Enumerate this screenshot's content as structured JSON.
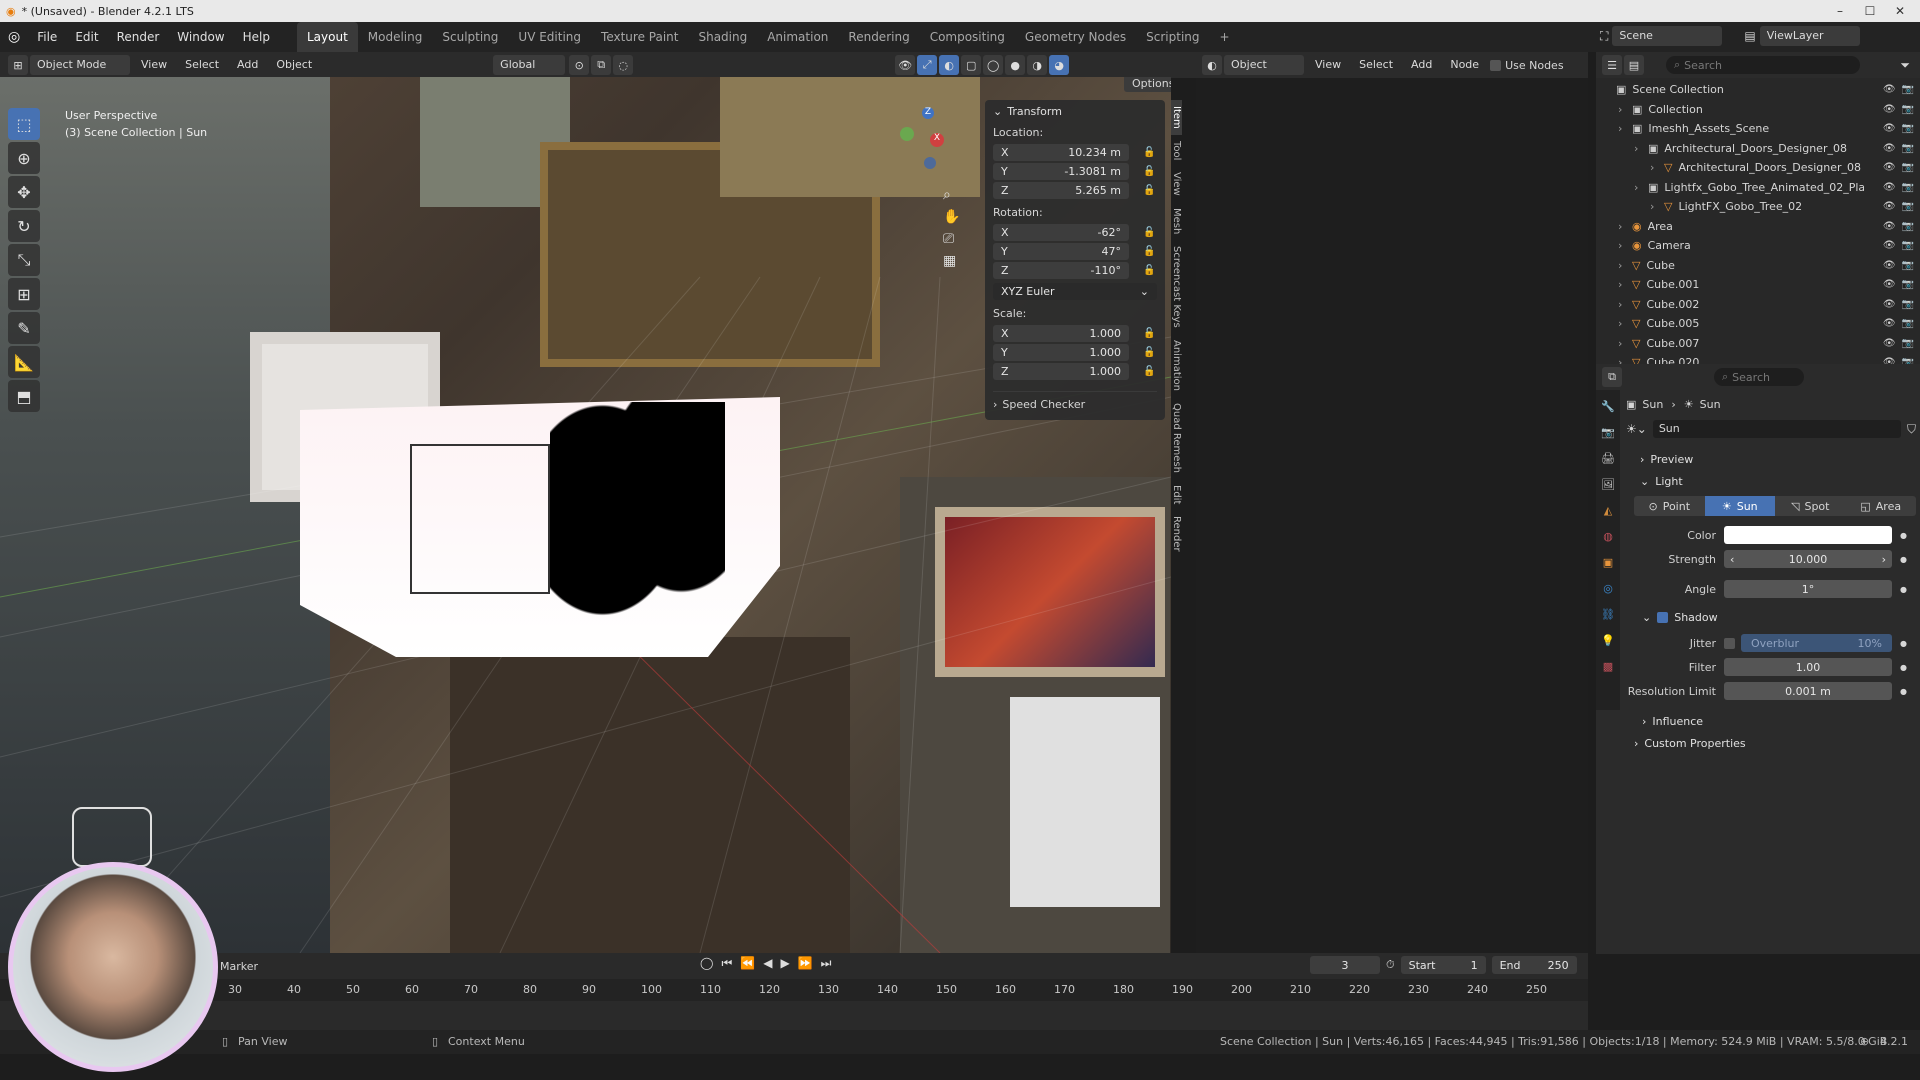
{
  "window": {
    "title": "* (Unsaved) - Blender 4.2.1 LTS",
    "controls": [
      "–",
      "☐",
      "✕"
    ]
  },
  "menu": {
    "items": [
      "File",
      "Edit",
      "Render",
      "Window",
      "Help"
    ]
  },
  "workspaces": [
    "Layout",
    "Modeling",
    "Sculpting",
    "UV Editing",
    "Texture Paint",
    "Shading",
    "Animation",
    "Rendering",
    "Compositing",
    "Geometry Nodes",
    "Scripting",
    "+"
  ],
  "scene": {
    "label": "Scene",
    "viewlayer": "ViewLayer"
  },
  "viewport_header": {
    "mode": "Object Mode",
    "view": "View",
    "select": "Select",
    "add": "Add",
    "object": "Object",
    "orientation": "Global",
    "options": "Options"
  },
  "viewport_overlay": {
    "perspective": "User Perspective",
    "collection": "(3) Scene Collection | Sun"
  },
  "npanel": {
    "title": "Transform",
    "location_label": "Location:",
    "location": [
      {
        "axis": "X",
        "value": "10.234 m"
      },
      {
        "axis": "Y",
        "value": "-1.3081 m"
      },
      {
        "axis": "Z",
        "value": "5.265 m"
      }
    ],
    "rotation_label": "Rotation:",
    "rotation": [
      {
        "axis": "X",
        "value": "-62°"
      },
      {
        "axis": "Y",
        "value": "47°"
      },
      {
        "axis": "Z",
        "value": "-110°"
      }
    ],
    "rotation_mode": "XYZ Euler",
    "scale_label": "Scale:",
    "scale": [
      {
        "axis": "X",
        "value": "1.000"
      },
      {
        "axis": "Y",
        "value": "1.000"
      },
      {
        "axis": "Z",
        "value": "1.000"
      }
    ],
    "speed_checker": "Speed Checker"
  },
  "side_tabs": [
    "Item",
    "Tool",
    "View",
    "Mesh",
    "Screencast Keys",
    "Animation",
    "Quad Remesh",
    "Edit",
    "Render"
  ],
  "node_header": {
    "object": "Object",
    "view": "View",
    "select": "Select",
    "add": "Add",
    "node": "Node",
    "use_nodes": "Use Nodes"
  },
  "outliner": {
    "search_placeholder": "Search",
    "rows": [
      {
        "indent": 0,
        "label": "Scene Collection",
        "icon": "▣"
      },
      {
        "indent": 1,
        "label": "Collection",
        "icon": "▣"
      },
      {
        "indent": 1,
        "label": "Imeshh_Assets_Scene",
        "icon": "▣"
      },
      {
        "indent": 2,
        "label": "Architectural_Doors_Designer_08",
        "icon": "▣"
      },
      {
        "indent": 3,
        "label": "Architectural_Doors_Designer_08",
        "icon": "▽"
      },
      {
        "indent": 2,
        "label": "Lightfx_Gobo_Tree_Animated_02_Pla",
        "icon": "▣"
      },
      {
        "indent": 3,
        "label": "LightFX_Gobo_Tree_02",
        "icon": "▽"
      },
      {
        "indent": 1,
        "label": "Area",
        "icon": "◉"
      },
      {
        "indent": 1,
        "label": "Camera",
        "icon": "◉"
      },
      {
        "indent": 1,
        "label": "Cube",
        "icon": "▽"
      },
      {
        "indent": 1,
        "label": "Cube.001",
        "icon": "▽"
      },
      {
        "indent": 1,
        "label": "Cube.002",
        "icon": "▽"
      },
      {
        "indent": 1,
        "label": "Cube.005",
        "icon": "▽"
      },
      {
        "indent": 1,
        "label": "Cube.007",
        "icon": "▽"
      },
      {
        "indent": 1,
        "label": "Cube.020",
        "icon": "▽"
      }
    ]
  },
  "properties": {
    "search_placeholder": "Search",
    "breadcrumb": [
      "Sun",
      "Sun"
    ],
    "datablock": "Sun",
    "preview": "Preview",
    "light": "Light",
    "types": [
      "Point",
      "Sun",
      "Spot",
      "Area"
    ],
    "active_type": "Sun",
    "color_label": "Color",
    "strength_label": "Strength",
    "strength": "10.000",
    "angle_label": "Angle",
    "angle": "1°",
    "shadow": "Shadow",
    "jitter_label": "Jitter",
    "jitter_overblur": "Overblur",
    "jitter_pct": "10%",
    "filter_label": "Filter",
    "filter": "1.00",
    "reslimit_label": "Resolution Limit",
    "reslimit": "0.001 m",
    "influence": "Influence",
    "custom": "Custom Properties"
  },
  "timeline": {
    "marker": "Marker",
    "current_frame": "3",
    "start_label": "Start",
    "start": "1",
    "end_label": "End",
    "end": "250",
    "ticks": [
      "30",
      "40",
      "50",
      "60",
      "70",
      "80",
      "90",
      "100",
      "110",
      "120",
      "130",
      "140",
      "150",
      "160",
      "170",
      "180",
      "190",
      "200",
      "210",
      "220",
      "230",
      "240",
      "250"
    ]
  },
  "status": {
    "pan": "Pan View",
    "context": "Context Menu",
    "info": "Scene Collection | Sun | Verts:46,165 | Faces:44,945 | Tris:91,586 | Objects:1/18 | Memory: 524.9 MiB | VRAM: 5.5/8.0 GiB",
    "version": "4.2.1"
  }
}
